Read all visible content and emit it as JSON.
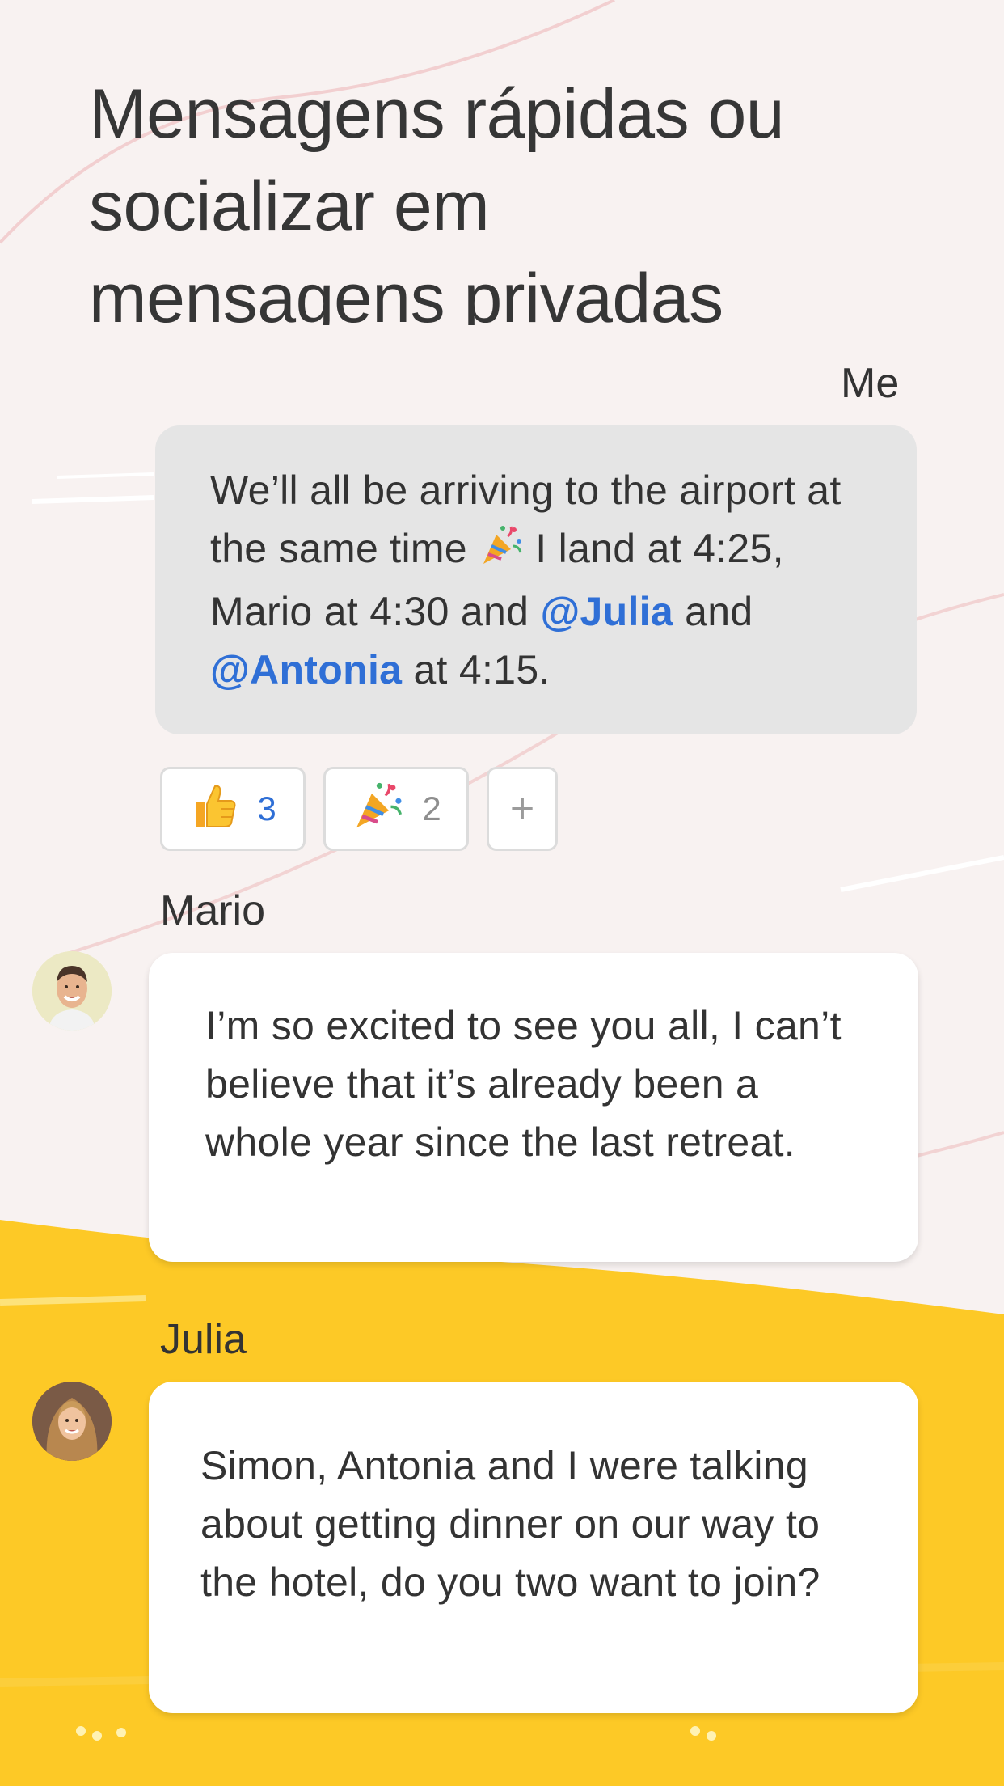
{
  "headline": {
    "line1": "Mensagens rápidas ou",
    "line2": "socializar em",
    "line3": "mensagens privadas"
  },
  "messages": [
    {
      "sender": "Me",
      "parts": [
        "We’ll all be arriving to the airport at the same time ",
        " I land at 4:25, Mario at 4:30 and ",
        "@Julia",
        " and ",
        "@Antonia",
        " at 4:15."
      ],
      "inline_icon": "party-popper-emoji"
    },
    {
      "sender": "Mario",
      "text": "I’m so excited to see you all, I can’t believe that it’s already been a whole year since the last retreat."
    },
    {
      "sender": "Julia",
      "text": "Simon, Antonia and I were talking about getting dinner on our way to the hotel, do you two want to join?"
    }
  ],
  "reactions": [
    {
      "icon": "thumbs-up-emoji",
      "count": "3",
      "active": true
    },
    {
      "icon": "party-popper-emoji",
      "count": "2",
      "active": false
    }
  ],
  "add_reaction_label": "+",
  "colors": {
    "background": "#f8f2f1",
    "yellow_band": "#fdc926",
    "mention": "#2f6fd6",
    "my_bubble": "#e5e5e5",
    "text": "#333333"
  }
}
